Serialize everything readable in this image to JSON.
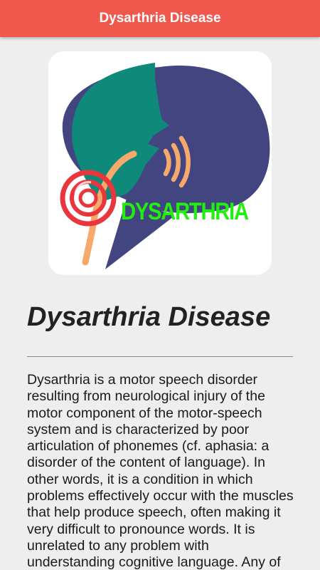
{
  "app_bar": {
    "title": "Dysarthria Disease"
  },
  "logo": {
    "text": "DYSARTHRIA",
    "colors": {
      "head": "#434580",
      "face": "#0f8a7a",
      "sound_waves": "#f5a96b",
      "ear": "#e8363c",
      "text": "#22ee11"
    }
  },
  "article": {
    "title": "Dysarthria Disease",
    "body": "Dysarthria is a motor speech disorder resulting from neurological injury of the motor component of the motor-speech system and is characterized by poor articulation of phonemes (cf. aphasia: a disorder of the content of language). In other words, it is a condition in which problems effectively occur with the muscles that help produce speech, often making it very difficult to pronounce words. It is unrelated to any problem with understanding cognitive language. Any of"
  },
  "theme": {
    "app_bar_color": "#f0584e",
    "background": "#eeeeee"
  }
}
